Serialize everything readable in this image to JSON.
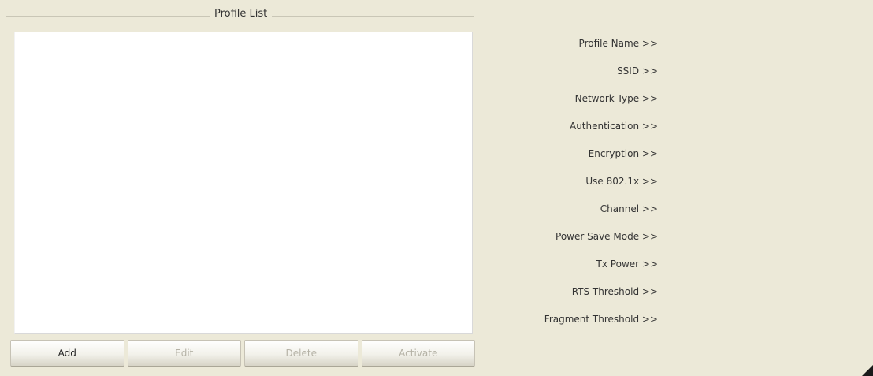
{
  "profile_list": {
    "title": "Profile List",
    "items": []
  },
  "buttons": {
    "add": "Add",
    "edit": "Edit",
    "delete": "Delete",
    "activate": "Activate"
  },
  "details": {
    "profile_name_label": "Profile Name >>",
    "profile_name_value": "",
    "ssid_label": "SSID >>",
    "ssid_value": "",
    "network_type_label": "Network Type >>",
    "network_type_value": "",
    "authentication_label": "Authentication >>",
    "authentication_value": "",
    "encryption_label": "Encryption >>",
    "encryption_value": "",
    "use_8021x_label": "Use 802.1x >>",
    "use_8021x_value": "",
    "channel_label": "Channel >>",
    "channel_value": "",
    "power_save_mode_label": "Power Save Mode >>",
    "power_save_mode_value": "",
    "tx_power_label": "Tx Power >>",
    "tx_power_value": "",
    "rts_threshold_label": "RTS Threshold >>",
    "rts_threshold_value": "",
    "fragment_threshold_label": "Fragment Threshold >>",
    "fragment_threshold_value": ""
  },
  "icons": {
    "resize_grip": "resize-grip-icon"
  },
  "colors": {
    "window_bg": "#ece9d8",
    "list_bg": "#ffffff",
    "disabled_text": "#b5b2a6"
  }
}
